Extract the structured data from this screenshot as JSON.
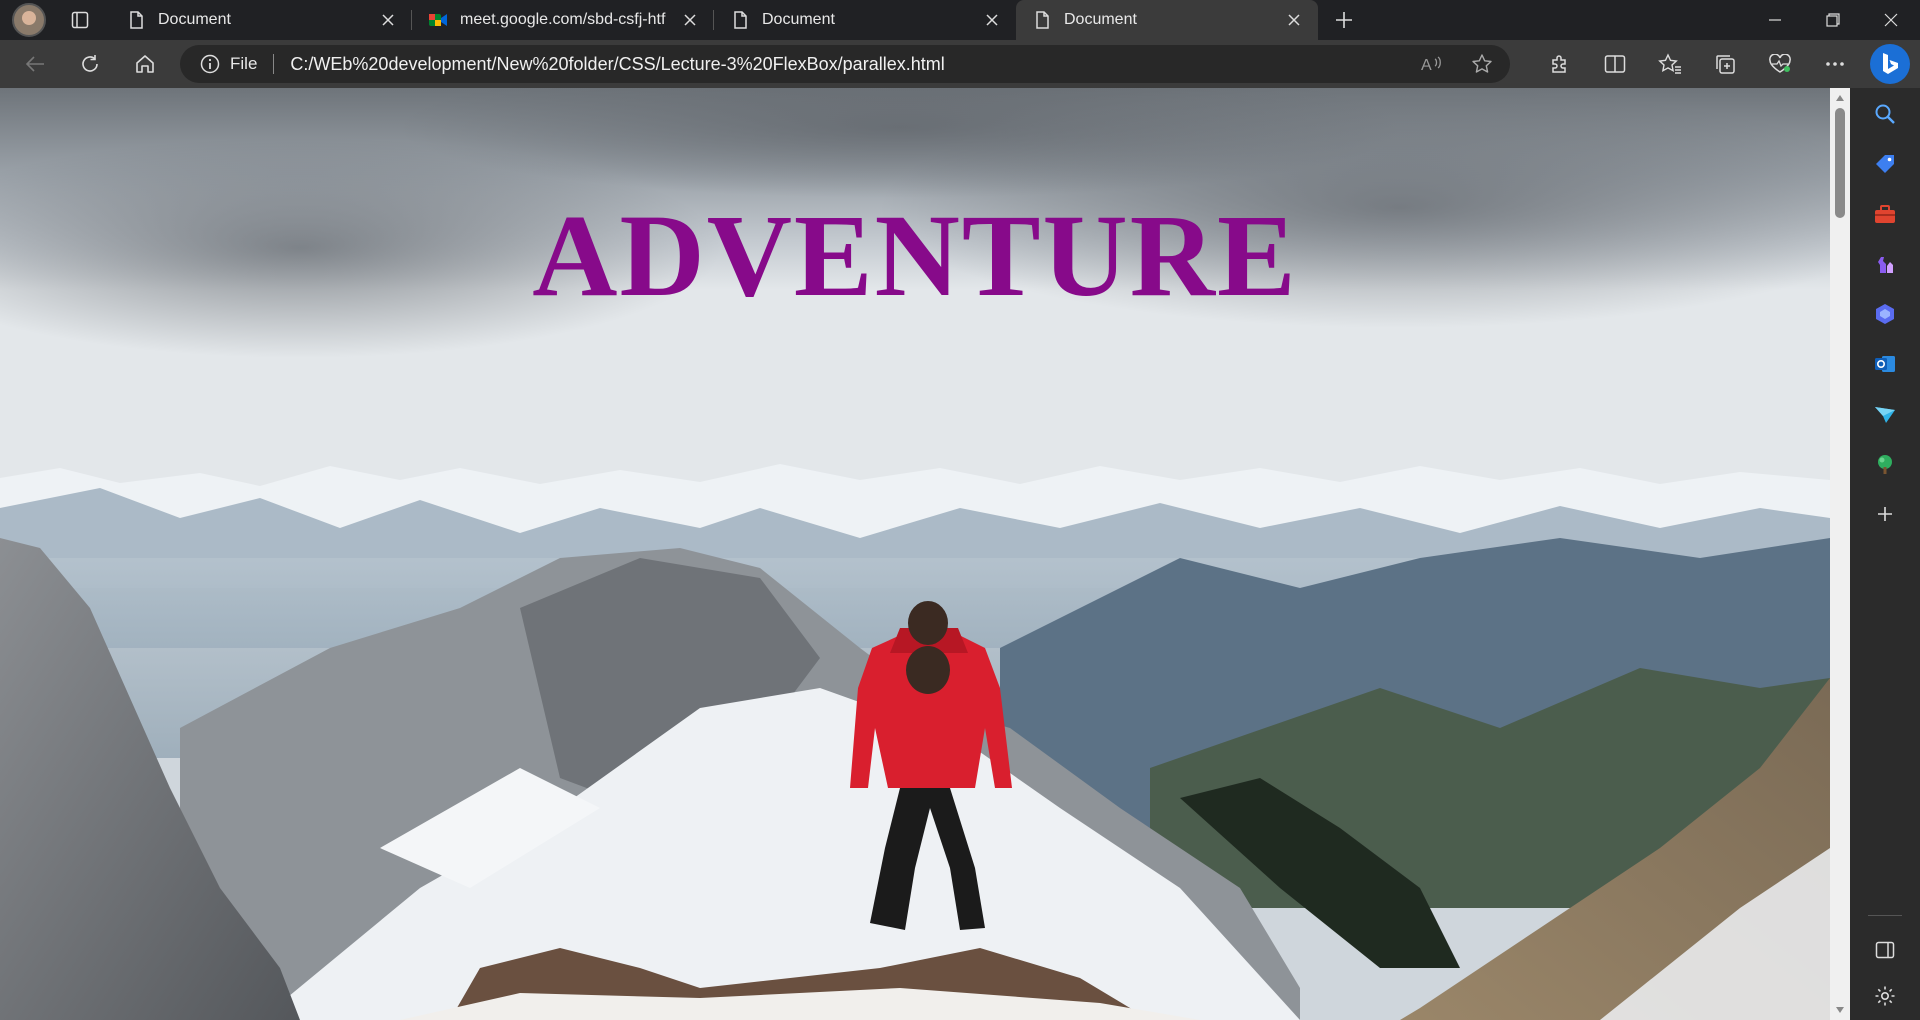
{
  "browser": {
    "tabs": [
      {
        "title": "Document",
        "favicon": "page-icon",
        "active": false
      },
      {
        "title": "meet.google.com/sbd-csfj-htf",
        "favicon": "google-meet-icon",
        "active": false
      },
      {
        "title": "Document",
        "favicon": "page-icon",
        "active": false
      },
      {
        "title": "Document",
        "favicon": "page-icon",
        "active": true
      }
    ],
    "address": {
      "scheme_label": "File",
      "url": "C:/WEb%20development/New%20folder/CSS/Lecture-3%20FlexBox/parallex.html"
    },
    "sidebar_icons": [
      "search-icon",
      "shopping-tag-icon",
      "toolbox-icon",
      "games-icon",
      "copilot-icon",
      "outlook-icon",
      "send-icon",
      "tree-icon",
      "add-icon",
      "split-panel-icon",
      "settings-icon"
    ]
  },
  "page": {
    "headline": "ADVENTURE",
    "headline_color": "#870a8a"
  }
}
